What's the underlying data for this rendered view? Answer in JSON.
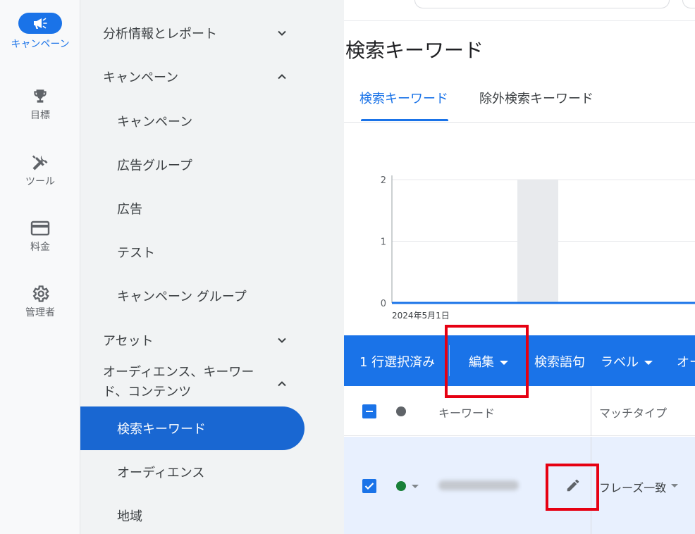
{
  "rail": {
    "items": [
      {
        "label": "キャンペーン",
        "icon": "megaphone-icon",
        "active": true
      },
      {
        "label": "目標",
        "icon": "trophy-icon"
      },
      {
        "label": "ツール",
        "icon": "tools-icon"
      },
      {
        "label": "料金",
        "icon": "credit-card-icon"
      },
      {
        "label": "管理者",
        "icon": "gear-icon"
      }
    ]
  },
  "nav": {
    "items": [
      {
        "label": "分析情報とレポート",
        "level": 1,
        "chevron": "down"
      },
      {
        "label": "キャンペーン",
        "level": 1,
        "chevron": "up"
      },
      {
        "label": "キャンペーン",
        "level": 2
      },
      {
        "label": "広告グループ",
        "level": 2
      },
      {
        "label": "広告",
        "level": 2
      },
      {
        "label": "テスト",
        "level": 2
      },
      {
        "label": "キャンペーン グループ",
        "level": 2
      },
      {
        "label": "アセット",
        "level": 1,
        "chevron": "down"
      },
      {
        "label": "オーディエンス、キーワード、コンテンツ",
        "level": 1,
        "chevron": "up",
        "line1": "オーディエンス、キーワー",
        "line2": "ド、コンテンツ"
      },
      {
        "label": "検索キーワード",
        "level": 2,
        "selected": true
      },
      {
        "label": "オーディエンス",
        "level": 2
      },
      {
        "label": "地域",
        "level": 2
      }
    ]
  },
  "main": {
    "title": "検索キーワード",
    "tabs": [
      {
        "label": "検索キーワード",
        "active": true
      },
      {
        "label": "除外検索キーワード"
      }
    ]
  },
  "chart_data": {
    "type": "line",
    "x": [
      "2024年5月1日"
    ],
    "y_ticks": [
      0,
      1,
      2
    ],
    "ylim": [
      0,
      2
    ],
    "series": [
      {
        "values": [
          0,
          0
        ]
      }
    ],
    "xlabel": "",
    "ylabel": "",
    "grid": true,
    "colors": {
      "line": "#1a73e8",
      "highlight_band": "#e8eaed"
    }
  },
  "toolbar": {
    "selected_count": "1 行選択済み",
    "edit": "編集",
    "search_terms": "検索語句",
    "label": "ラベル",
    "more": "オー"
  },
  "table": {
    "headers": {
      "keyword": "キーワード",
      "match_type": "マッチタイプ"
    },
    "rows": [
      {
        "match_type": "フレーズ一致",
        "status_color": "#188038",
        "checked": true
      }
    ]
  },
  "colors": {
    "accent": "#1a73e8",
    "selected_nav": "#1967d2",
    "highlight_box": "#e60012"
  }
}
